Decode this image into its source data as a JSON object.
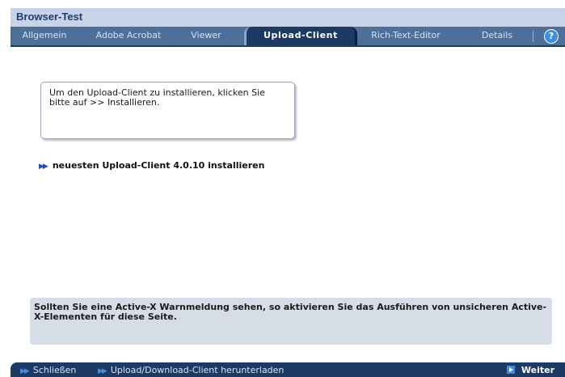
{
  "window": {
    "title": "Browser-Test"
  },
  "tabs": [
    {
      "label": "Allgemein"
    },
    {
      "label": "Adobe Acrobat"
    },
    {
      "label": "Viewer"
    },
    {
      "label": "Upload-Client",
      "active": true
    },
    {
      "label": "Rich-Text-Editor"
    },
    {
      "label": "Details"
    }
  ],
  "help": {
    "icon": "help-icon",
    "glyph": "?"
  },
  "info": {
    "text": "Um den Upload-Client zu installieren, klicken Sie bitte auf >> Installieren."
  },
  "install": {
    "label": "neuesten Upload-Client 4.0.10 installieren"
  },
  "warning": {
    "text": "Sollten Sie eine Active-X Warnmeldung sehen, so aktivieren Sie das Ausführen von unsicheren Active-X-Elementen für diese Seite."
  },
  "footer": {
    "close_label": "Schließen",
    "download_label": "Upload/Download-Client herunterladen",
    "next_label": "Weiter"
  },
  "colors": {
    "title_bar": "#c8d3e8",
    "tab_bar": "#4f6f9b",
    "active_tab": "#1c3a63",
    "warning_bg": "#d7dde6",
    "accent": "#3f8ae0"
  }
}
